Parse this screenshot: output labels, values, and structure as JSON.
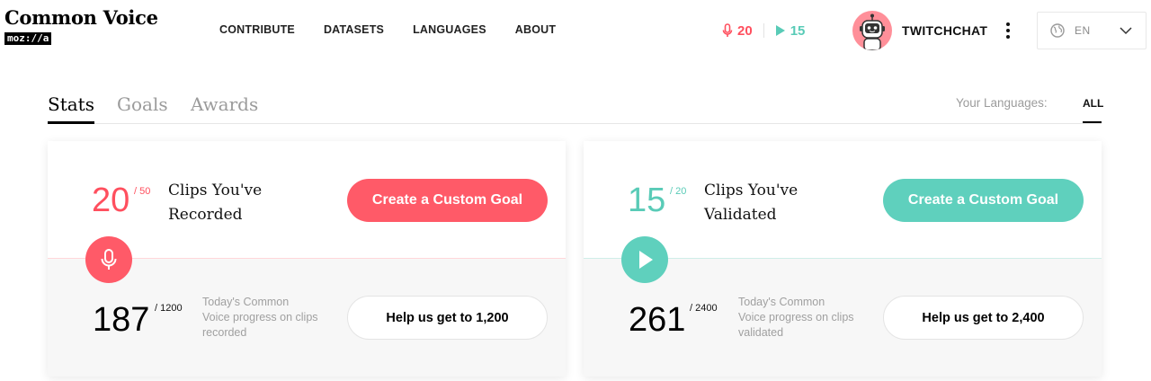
{
  "brand": {
    "title": "Common Voice",
    "sub": "moz://a"
  },
  "nav": {
    "items": [
      {
        "label": "CONTRIBUTE"
      },
      {
        "label": "DATASETS"
      },
      {
        "label": "LANGUAGES"
      },
      {
        "label": "ABOUT"
      }
    ]
  },
  "header_counts": {
    "recorded": "20",
    "validated": "15"
  },
  "user": {
    "name": "TWITCHCHAT",
    "avatar_icon": "robot-avatar"
  },
  "language_select": {
    "value": "EN",
    "icon": "globe-icon"
  },
  "tabs": {
    "items": [
      {
        "label": "Stats",
        "active": true
      },
      {
        "label": "Goals",
        "active": false
      },
      {
        "label": "Awards",
        "active": false
      }
    ]
  },
  "languages_filter": {
    "label": "Your Languages:",
    "selected": "ALL"
  },
  "cards": {
    "recorded": {
      "goal_value": "20",
      "goal_total": "/ 50",
      "label_line1": "Clips You've",
      "label_line2": "Recorded",
      "goal_button": "Create a Custom Goal",
      "icon": "microphone-icon",
      "progress_value": "187",
      "progress_total": "/ 1200",
      "progress_desc": "Today's Common Voice progress on clips recorded",
      "help_button": "Help us get to 1,200",
      "accent": "#ff4f5e"
    },
    "validated": {
      "goal_value": "15",
      "goal_total": "/ 20",
      "label_line1": "Clips You've",
      "label_line2": "Validated",
      "goal_button": "Create a Custom Goal",
      "icon": "play-icon",
      "progress_value": "261",
      "progress_total": "/ 2400",
      "progress_desc": "Today's Common Voice progress on clips validated",
      "help_button": "Help us get to 2,400",
      "accent": "#59cbb7"
    }
  }
}
